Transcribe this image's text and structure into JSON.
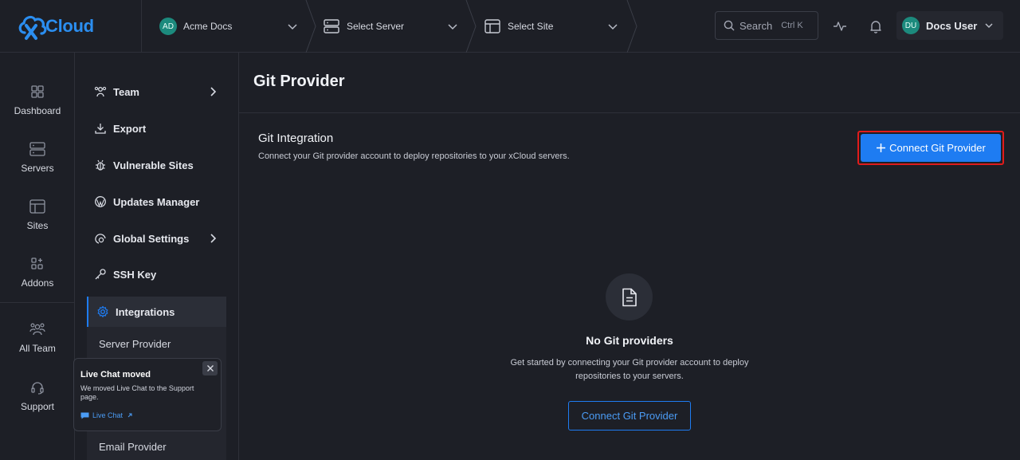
{
  "brand": {
    "logo_text": "Cloud",
    "logo_mark": "x"
  },
  "topbar": {
    "team": {
      "initials": "AD",
      "label": "Acme Docs"
    },
    "server": {
      "label": "Select Server"
    },
    "site": {
      "label": "Select Site"
    },
    "search": {
      "label": "Search",
      "shortcut": "Ctrl K"
    },
    "user": {
      "initials": "DU",
      "name": "Docs User"
    }
  },
  "rail": {
    "items": [
      {
        "label": "Dashboard",
        "icon": "grid-icon"
      },
      {
        "label": "Servers",
        "icon": "server-icon"
      },
      {
        "label": "Sites",
        "icon": "layout-icon"
      },
      {
        "label": "Addons",
        "icon": "addons-icon"
      },
      {
        "label": "All Team",
        "icon": "team-icon"
      },
      {
        "label": "Support",
        "icon": "headset-icon"
      }
    ]
  },
  "menu": {
    "items": [
      {
        "label": "Team",
        "icon": "users-icon",
        "has_children": true
      },
      {
        "label": "Export",
        "icon": "download-icon"
      },
      {
        "label": "Vulnerable Sites",
        "icon": "bug-icon"
      },
      {
        "label": "Updates Manager",
        "icon": "wordpress-icon"
      },
      {
        "label": "Global Settings",
        "icon": "globe-gear-icon",
        "has_children": true
      },
      {
        "label": "SSH Key",
        "icon": "key-icon"
      }
    ],
    "active": {
      "label": "Integrations",
      "icon": "gear-icon"
    },
    "sub_items": [
      "Server Provider",
      "Email Provider"
    ]
  },
  "toast": {
    "title": "Live Chat moved",
    "body": "We moved Live Chat to the Support page.",
    "link": "Live Chat"
  },
  "main": {
    "page_title": "Git Provider",
    "section_title": "Git Integration",
    "section_desc": "Connect your Git provider account to deploy repositories to your xCloud servers.",
    "primary_button": "Connect Git Provider",
    "empty_title": "No Git providers",
    "empty_desc": "Get started by connecting your Git provider account to deploy repositories to your servers.",
    "empty_button": "Connect Git Provider"
  },
  "colors": {
    "accent": "#1e7cf2",
    "brand": "#2b8ef0",
    "highlight": "#e01b1b",
    "avatar": "#1c8a7d"
  }
}
